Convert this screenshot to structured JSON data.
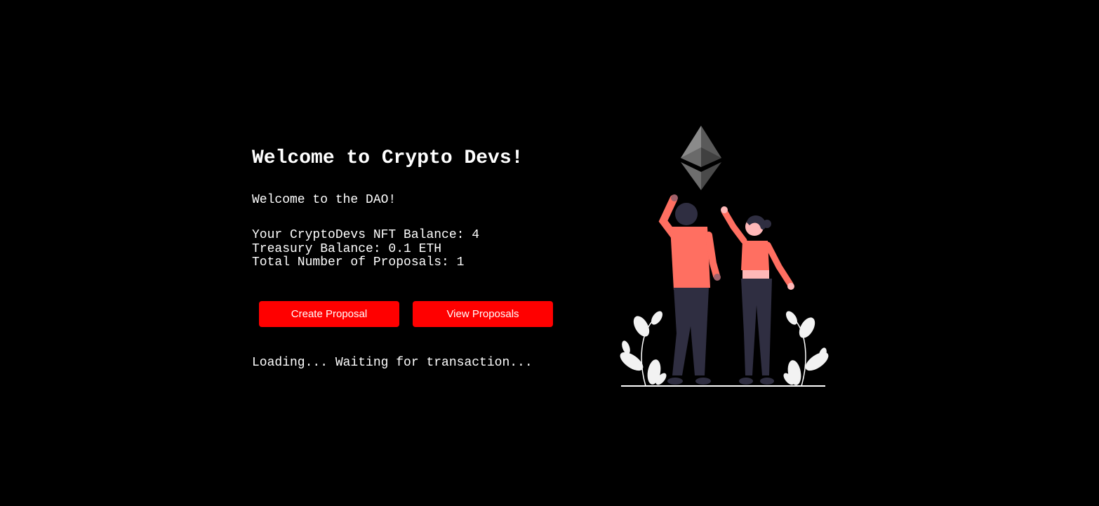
{
  "main": {
    "title": "Welcome to Crypto Devs!",
    "description": "Welcome to the DAO!",
    "stats": {
      "nft_balance": "Your CryptoDevs NFT Balance: 4",
      "treasury_balance": "Treasury Balance: 0.1 ETH",
      "proposal_count": "Total Number of Proposals: 1"
    },
    "buttons": {
      "create_label": "Create Proposal",
      "view_label": "View Proposals"
    },
    "status": "Loading... Waiting for transaction..."
  },
  "illustration": {
    "icon": "ethereum-icon"
  },
  "colors": {
    "background": "#000000",
    "text": "#ffffff",
    "button": "#ff0000",
    "figure_shirt": "#ff6f61",
    "figure_pants": "#2f2e41"
  }
}
